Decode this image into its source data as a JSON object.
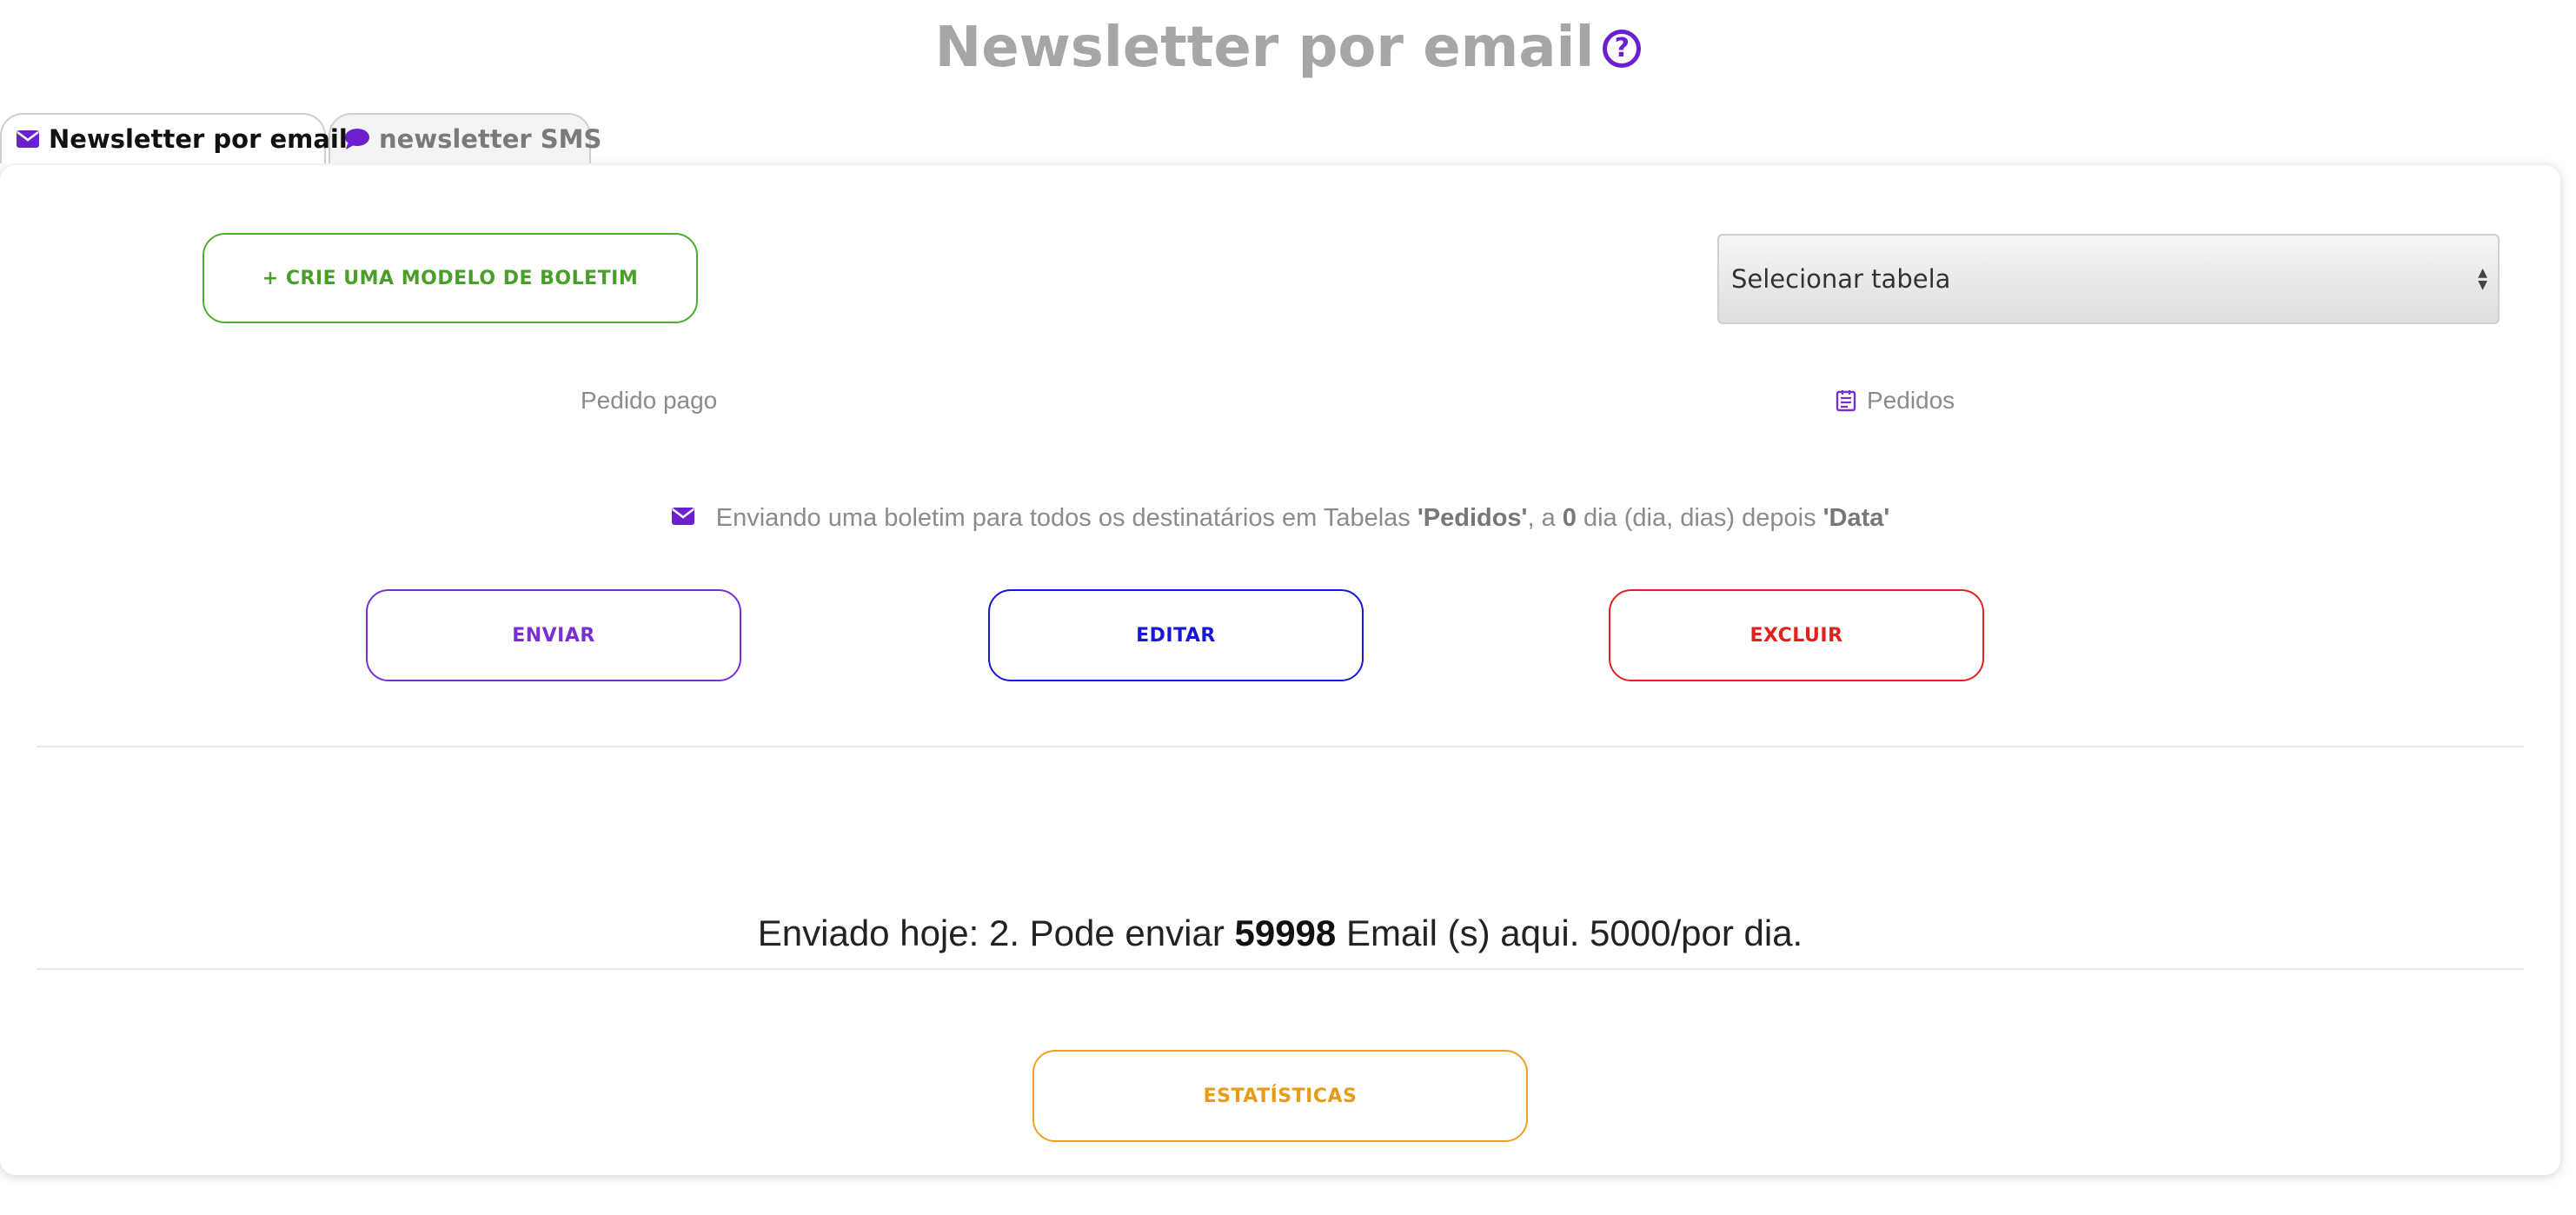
{
  "page": {
    "title": "Newsletter por email",
    "help_icon": "question-circle-icon"
  },
  "tabs": [
    {
      "label": "Newsletter por email",
      "icon": "envelope-icon",
      "active": true
    },
    {
      "label": "newsletter SMS",
      "icon": "comment-icon",
      "active": false
    }
  ],
  "panel": {
    "create_button_label": "+ CRIE UMA MODELO DE BOLETIM",
    "select_table": {
      "selected": "Selecionar tabela"
    },
    "status_label": "Pedido pago",
    "table_label": "Pedidos",
    "description": {
      "prefix": "Enviando uma boletim para todos os destinatários em Tabelas",
      "table": "'Pedidos'",
      "mid": ", a",
      "days": "0",
      "after_days": "dia (dia, dias) depois",
      "field": "'Data'"
    },
    "send_button_label": "ENVIAR",
    "edit_button_label": "EDITAR",
    "delete_button_label": "EXCLUIR",
    "sent_today": {
      "prefix": "Enviado hoje: 2. Pode enviar",
      "count": "59998",
      "suffix": "Email (s) aqui. 5000/por dia."
    },
    "stats_button_label": "ESTATÍSTICAS"
  },
  "colors": {
    "accent_purple": "#6c1fcf",
    "green": "#4cae2c",
    "blue": "#1a16d8",
    "red": "#e0221f",
    "orange": "#f0a21f"
  }
}
